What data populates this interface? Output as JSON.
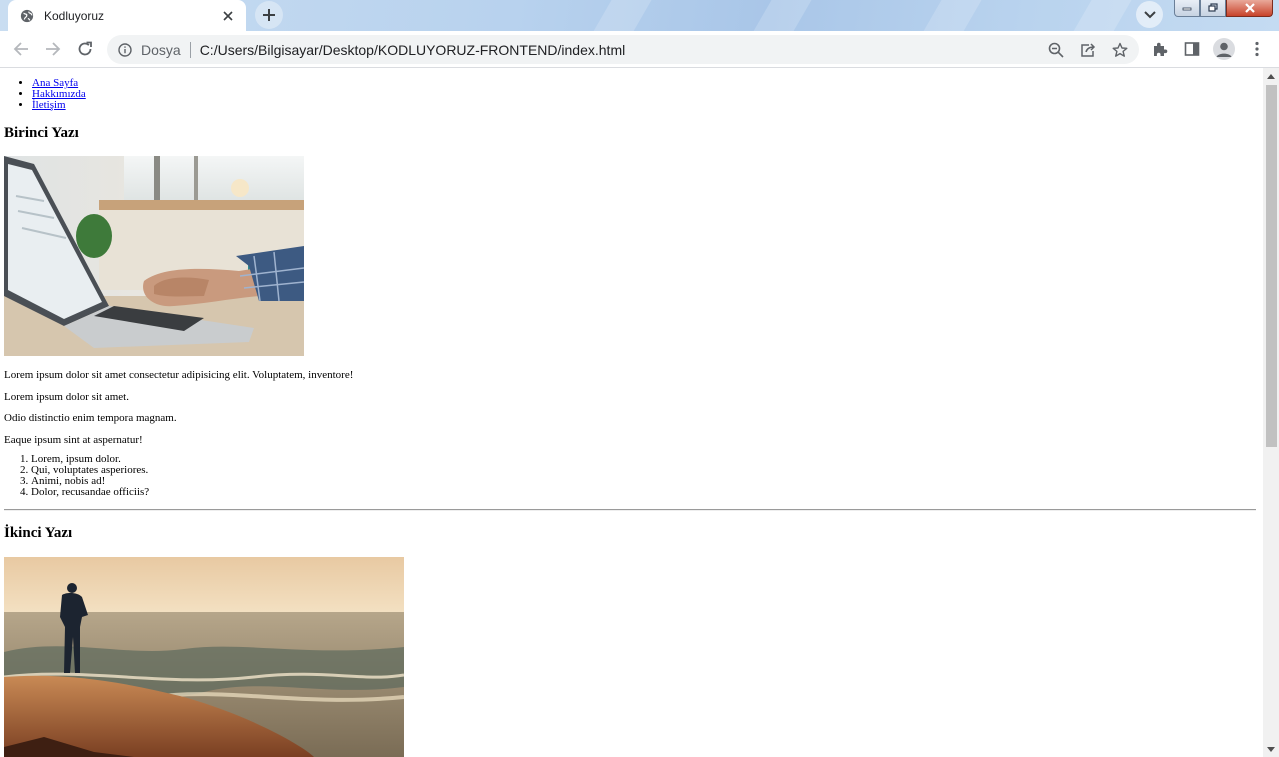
{
  "browser": {
    "tab_title": "Kodluyoruz",
    "scheme_label": "Dosya",
    "url": "C:/Users/Bilgisayar/Desktop/KODLUYORUZ-FRONTEND/index.html"
  },
  "icons": {
    "favicon": "globe-icon",
    "tab_close": "close-icon",
    "new_tab": "plus-icon",
    "tab_search": "chevron-down-icon",
    "back": "arrow-left-icon",
    "forward": "arrow-right-icon",
    "reload": "reload-icon",
    "site_info": "info-icon",
    "zoom": "magnifier-minus-icon",
    "share": "share-icon",
    "bookmark": "star-icon",
    "extensions": "puzzle-icon",
    "side_panel": "side-panel-icon",
    "profile": "person-icon",
    "menu": "kebab-menu-icon"
  },
  "page": {
    "nav": [
      "Ana Sayfa",
      "Hakkımızda",
      "İletişim"
    ],
    "post1": {
      "title": "Birinci Yazı",
      "paragraphs": [
        "Lorem ipsum dolor sit amet consectetur adipisicing elit. Voluptatem, inventore!",
        "Lorem ipsum dolor sit amet.",
        "Odio distinctio enim tempora magnam.",
        "Eaque ipsum sint at aspernatur!"
      ],
      "list": [
        "Lorem, ipsum dolor.",
        "Qui, voluptates asperiores.",
        "Animi, nobis ad!",
        "Dolor, recusandae officiis?"
      ]
    },
    "post2": {
      "title": "İkinci Yazı"
    }
  }
}
